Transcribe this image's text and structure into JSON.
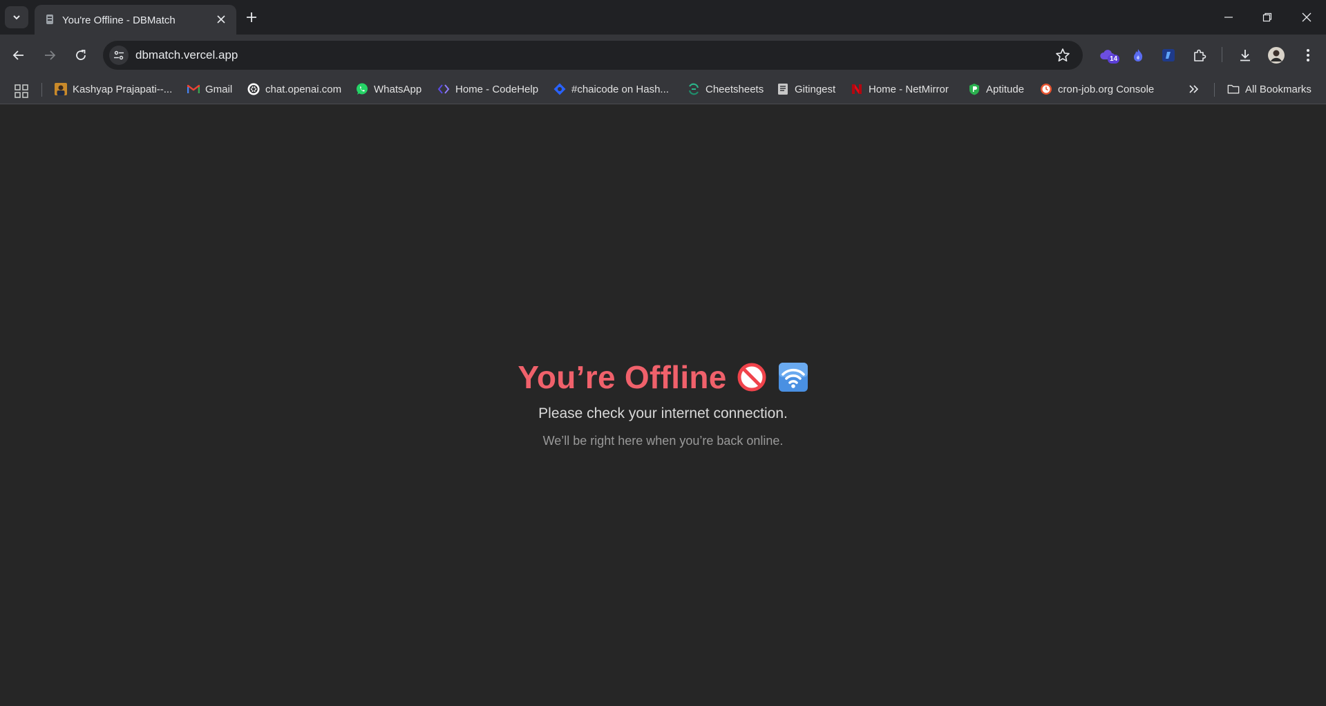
{
  "tab": {
    "title": "You're Offline - DBMatch"
  },
  "toolbar": {
    "url": "dbmatch.vercel.app",
    "extension_badge": "14"
  },
  "bookmarks": [
    {
      "label": "Kashyap Prajapati--...",
      "icon": "profile-photo-icon",
      "color": "#c98a2a"
    },
    {
      "label": "Gmail",
      "icon": "gmail-icon",
      "color": "#ea4335"
    },
    {
      "label": "chat.openai.com",
      "icon": "openai-icon",
      "color": "#ffffff"
    },
    {
      "label": "WhatsApp",
      "icon": "whatsapp-icon",
      "color": "#25d366"
    },
    {
      "label": "Home - CodeHelp",
      "icon": "codehelp-icon",
      "color": "#5b4be8"
    },
    {
      "label": "#chaicode on Hash...",
      "icon": "hashnode-icon",
      "color": "#2962ff"
    },
    {
      "label": "Cheetsheets",
      "icon": "cheatsheets-icon",
      "color": "#2bb58a"
    },
    {
      "label": "Gitingest",
      "icon": "gitingest-icon",
      "color": "#c7c7c7"
    },
    {
      "label": "Home - NetMirror",
      "icon": "netmirror-icon",
      "color": "#e50914"
    },
    {
      "label": "Aptitude",
      "icon": "aptitude-icon",
      "color": "#2bb04f"
    },
    {
      "label": "cron-job.org Console",
      "icon": "cronjob-icon",
      "color": "#e8542f"
    }
  ],
  "all_bookmarks_label": "All Bookmarks",
  "offline": {
    "headline": "You’re Offline",
    "line1": "Please check your internet connection.",
    "line2": "We’ll be right here when you’re back online.",
    "headline_color": "#f0616b"
  }
}
